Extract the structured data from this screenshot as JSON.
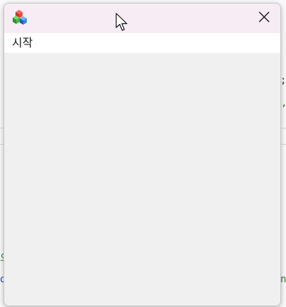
{
  "window": {
    "icon": "application-cubes-icon",
    "close_icon": "close-icon"
  },
  "menu": {
    "items": [
      {
        "label": "시작"
      }
    ]
  },
  "background": {
    "fragments": [
      {
        "text": ";",
        "color": "#333333"
      },
      {
        "text": ",",
        "color": "#2e7d32"
      },
      {
        "text": "으",
        "color": "#2e7d32"
      },
      {
        "text": "d",
        "color": "#1f4fbf"
      },
      {
        "text": "n",
        "color": "#2e7d32"
      }
    ]
  },
  "colors": {
    "titlebar_bg": "#f8ecf4",
    "menubar_bg": "#ffffff",
    "client_bg": "#f0f0f0"
  }
}
